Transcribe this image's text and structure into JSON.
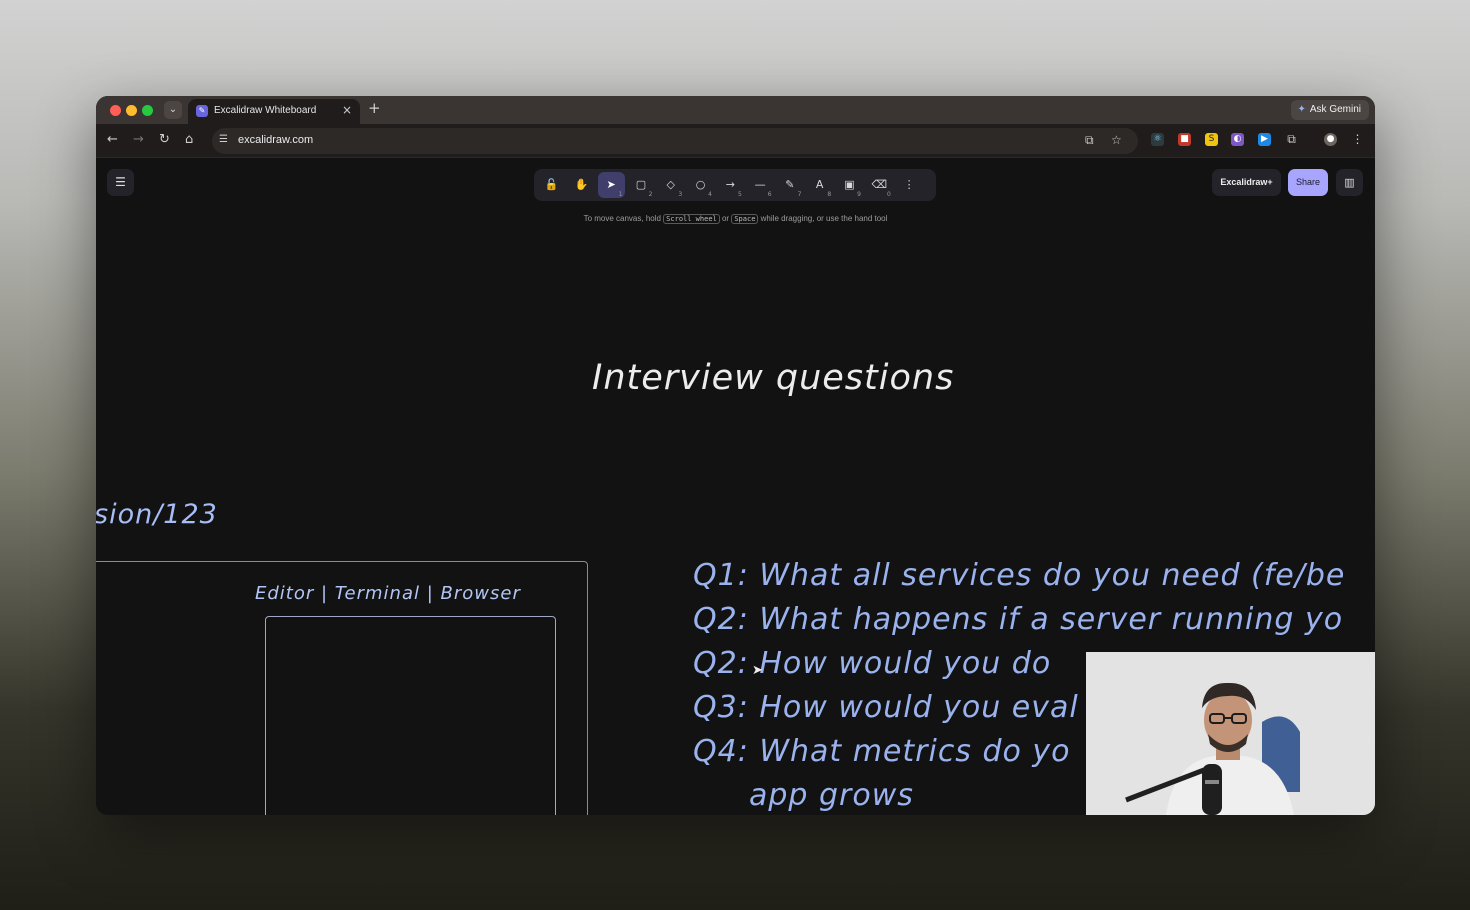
{
  "browser": {
    "tab_title": "Excalidraw Whiteboard",
    "ask_gemini": "Ask Gemini",
    "url": "excalidraw.com",
    "icons": [
      "tab-search-icon",
      "close-icon",
      "plus-icon",
      "back-icon",
      "forward-icon",
      "reload-icon",
      "home-icon",
      "site-info-icon",
      "install-icon",
      "star-icon",
      "extensions-icon",
      "profile-icon",
      "more-icon"
    ]
  },
  "excalidraw": {
    "tools": [
      {
        "name": "lock",
        "glyph": "🔓",
        "key": ""
      },
      {
        "name": "hand",
        "glyph": "✋",
        "key": ""
      },
      {
        "name": "selection",
        "glyph": "➤",
        "key": "1",
        "active": true
      },
      {
        "name": "rectangle",
        "glyph": "▢",
        "key": "2"
      },
      {
        "name": "diamond",
        "glyph": "◇",
        "key": "3"
      },
      {
        "name": "ellipse",
        "glyph": "○",
        "key": "4"
      },
      {
        "name": "arrow",
        "glyph": "→",
        "key": "5"
      },
      {
        "name": "line",
        "glyph": "—",
        "key": "6"
      },
      {
        "name": "draw",
        "glyph": "✎",
        "key": "7"
      },
      {
        "name": "text",
        "glyph": "A",
        "key": "8"
      },
      {
        "name": "image",
        "glyph": "▣",
        "key": "9"
      },
      {
        "name": "eraser",
        "glyph": "⌫",
        "key": "0"
      },
      {
        "name": "more",
        "glyph": "⋮",
        "key": ""
      }
    ],
    "hint_prefix": "To move canvas, hold",
    "hint_key1": "Scroll wheel",
    "hint_or": "or",
    "hint_key2": "Space",
    "hint_suffix": "while dragging, or use the hand tool",
    "excalidraw_plus": "Excalidraw+",
    "share": "Share",
    "accent_color": "#a8a5ff"
  },
  "canvas": {
    "heading": "Interview questions",
    "url_fragment": "sion/123",
    "frame_label": "Editor | Terminal | Browser",
    "questions": [
      "Q1: What all services do you need (fe/be",
      "Q2: What happens if a server running yo",
      "Q2: How would you do",
      "Q3: How would you eval",
      "Q4: What metrics do yo",
      "app grows"
    ]
  }
}
